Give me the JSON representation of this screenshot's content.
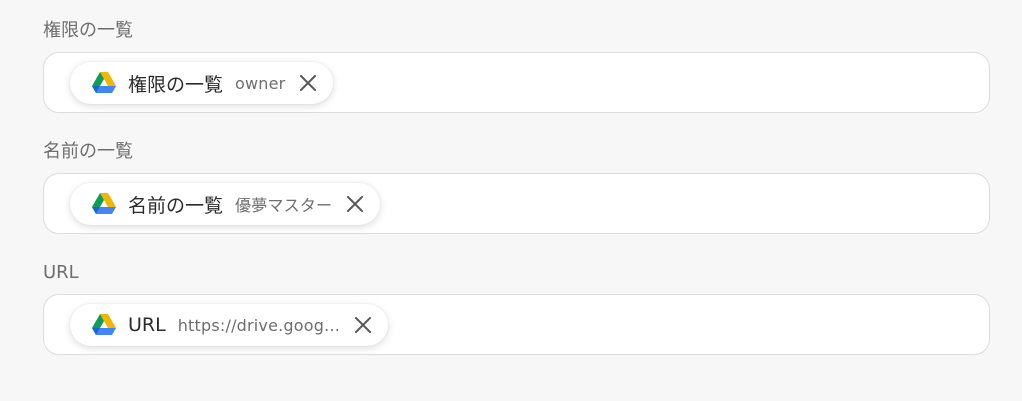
{
  "fields": [
    {
      "label": "権限の一覧",
      "chip": {
        "icon": "google-drive-icon",
        "label": "権限の一覧",
        "value": "owner"
      }
    },
    {
      "label": "名前の一覧",
      "chip": {
        "icon": "google-drive-icon",
        "label": "名前の一覧",
        "value": "優夢マスター"
      }
    },
    {
      "label": "URL",
      "chip": {
        "icon": "google-drive-icon",
        "label": "URL",
        "value": "https://drive.goog..."
      }
    }
  ],
  "colors": {
    "background": "#f7f7f7",
    "field_border": "#dcdcdc",
    "label_text": "#6e6e6e",
    "chip_text": "#2b2b2b",
    "drive_green": "#0f9d58",
    "drive_yellow": "#f4b400",
    "drive_blue": "#4285f4"
  }
}
